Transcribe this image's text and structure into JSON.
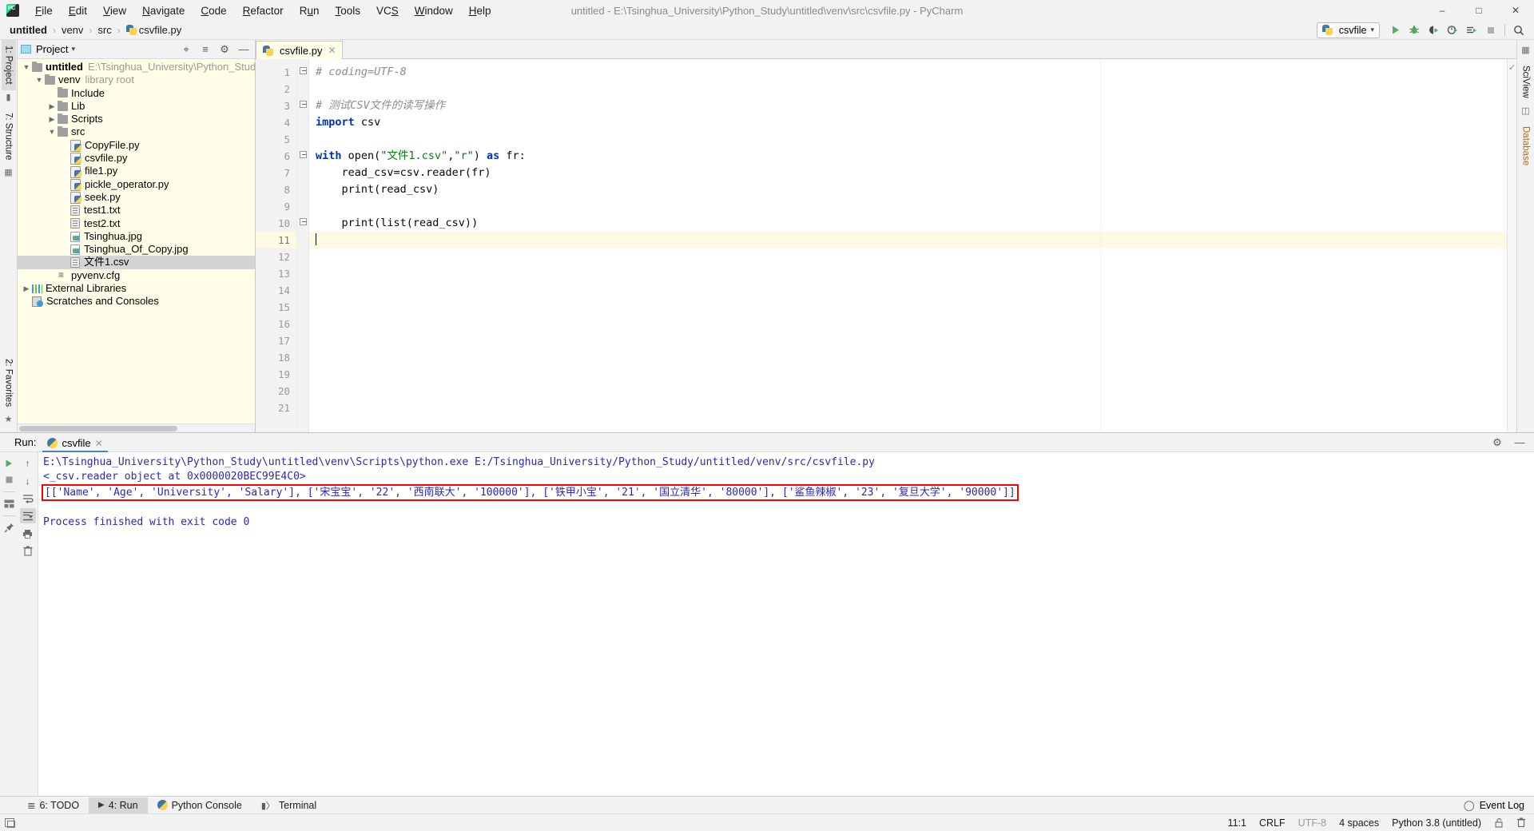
{
  "window": {
    "title": "untitled - E:\\Tsinghua_University\\Python_Study\\untitled\\venv\\src\\csvfile.py - PyCharm",
    "minimize": "–",
    "maximize": "□",
    "close": "✕"
  },
  "menu": {
    "items": [
      {
        "label": "File"
      },
      {
        "label": "Edit"
      },
      {
        "label": "View"
      },
      {
        "label": "Navigate"
      },
      {
        "label": "Code"
      },
      {
        "label": "Refactor"
      },
      {
        "label": "Run"
      },
      {
        "label": "Tools"
      },
      {
        "label": "VCS"
      },
      {
        "label": "Window"
      },
      {
        "label": "Help"
      }
    ]
  },
  "breadcrumb": {
    "items": [
      "untitled",
      "venv",
      "src",
      "csvfile.py"
    ],
    "separator": "›"
  },
  "toolbar": {
    "run_config": "csvfile",
    "dropdown_caret": "▾",
    "buttons": [
      {
        "name": "run-button",
        "glyph": "▶"
      },
      {
        "name": "debug-button",
        "glyph": "⚙"
      },
      {
        "name": "run-with-coverage-button",
        "glyph": "◑"
      },
      {
        "name": "profile-button",
        "glyph": "◴"
      },
      {
        "name": "run-tests-button",
        "glyph": "☰"
      },
      {
        "name": "stop-button",
        "glyph": "■"
      },
      {
        "name": "search-everywhere-button",
        "glyph": "⌕"
      }
    ]
  },
  "left_strip": {
    "project_tab": "1: Project",
    "structure_tab": "7: Structure",
    "favorites_tab": "2: Favorites"
  },
  "right_strip": {
    "sciview_tab": "SciView",
    "database_tab": "Database"
  },
  "project_panel": {
    "title": "Project",
    "caret": "▾",
    "header_buttons": [
      {
        "name": "locate-file-button",
        "glyph": "⌖"
      },
      {
        "name": "collapse-all-button",
        "glyph": "≡"
      },
      {
        "name": "settings-gear-button",
        "glyph": "⚙"
      },
      {
        "name": "hide-panel-button",
        "glyph": "—"
      }
    ],
    "tree": [
      {
        "indent": 0,
        "arrow": "▼",
        "icon": "folder",
        "label": "untitled",
        "bold": true,
        "sub": "E:\\Tsinghua_University\\Python_Stud",
        "selected": false
      },
      {
        "indent": 1,
        "arrow": "▼",
        "icon": "folder",
        "label": "venv",
        "bold": false,
        "sub": "library root",
        "selected": false
      },
      {
        "indent": 2,
        "arrow": "",
        "icon": "folder",
        "label": "Include",
        "bold": false,
        "sub": "",
        "selected": false
      },
      {
        "indent": 2,
        "arrow": "▶",
        "icon": "folder",
        "label": "Lib",
        "bold": false,
        "sub": "",
        "selected": false
      },
      {
        "indent": 2,
        "arrow": "▶",
        "icon": "folder",
        "label": "Scripts",
        "bold": false,
        "sub": "",
        "selected": false
      },
      {
        "indent": 2,
        "arrow": "▼",
        "icon": "folder",
        "label": "src",
        "bold": false,
        "sub": "",
        "selected": false
      },
      {
        "indent": 3,
        "arrow": "",
        "icon": "python",
        "label": "CopyFile.py",
        "bold": false,
        "sub": "",
        "selected": false
      },
      {
        "indent": 3,
        "arrow": "",
        "icon": "python",
        "label": "csvfile.py",
        "bold": false,
        "sub": "",
        "selected": false
      },
      {
        "indent": 3,
        "arrow": "",
        "icon": "python",
        "label": "file1.py",
        "bold": false,
        "sub": "",
        "selected": false
      },
      {
        "indent": 3,
        "arrow": "",
        "icon": "python",
        "label": "pickle_operator.py",
        "bold": false,
        "sub": "",
        "selected": false
      },
      {
        "indent": 3,
        "arrow": "",
        "icon": "python",
        "label": "seek.py",
        "bold": false,
        "sub": "",
        "selected": false
      },
      {
        "indent": 3,
        "arrow": "",
        "icon": "text",
        "label": "test1.txt",
        "bold": false,
        "sub": "",
        "selected": false
      },
      {
        "indent": 3,
        "arrow": "",
        "icon": "text",
        "label": "test2.txt",
        "bold": false,
        "sub": "",
        "selected": false
      },
      {
        "indent": 3,
        "arrow": "",
        "icon": "image",
        "label": "Tsinghua.jpg",
        "bold": false,
        "sub": "",
        "selected": false
      },
      {
        "indent": 3,
        "arrow": "",
        "icon": "image",
        "label": "Tsinghua_Of_Copy.jpg",
        "bold": false,
        "sub": "",
        "selected": false
      },
      {
        "indent": 3,
        "arrow": "",
        "icon": "text",
        "label": "文件1.csv",
        "bold": false,
        "sub": "",
        "selected": true
      },
      {
        "indent": 2,
        "arrow": "",
        "icon": "config",
        "label": "pyvenv.cfg",
        "bold": false,
        "sub": "",
        "selected": false
      },
      {
        "indent": 0,
        "arrow": "▶",
        "icon": "library",
        "label": "External Libraries",
        "bold": false,
        "sub": "",
        "selected": false
      },
      {
        "indent": 0,
        "arrow": "",
        "icon": "scratch",
        "label": "Scratches and Consoles",
        "bold": false,
        "sub": "",
        "selected": false
      }
    ]
  },
  "editor": {
    "tab": {
      "label": "csvfile.py",
      "close_glyph": "✕"
    },
    "total_lines": 21,
    "current_line": 11,
    "lines": [
      {
        "n": 1,
        "fold": "open",
        "tokens": [
          {
            "t": "# coding=UTF-8",
            "c": "cmt"
          }
        ]
      },
      {
        "n": 2,
        "fold": "",
        "tokens": []
      },
      {
        "n": 3,
        "fold": "box",
        "tokens": [
          {
            "t": "# 测试CSV文件的读写操作",
            "c": "cmt"
          }
        ]
      },
      {
        "n": 4,
        "fold": "",
        "tokens": [
          {
            "t": "import",
            "c": "kw"
          },
          {
            "t": " csv",
            "c": "plain"
          }
        ]
      },
      {
        "n": 5,
        "fold": "",
        "tokens": []
      },
      {
        "n": 6,
        "fold": "open",
        "tokens": [
          {
            "t": "with",
            "c": "kw"
          },
          {
            "t": " open(",
            "c": "plain"
          },
          {
            "t": "\"文件1.csv\"",
            "c": "str"
          },
          {
            "t": ",",
            "c": "plain"
          },
          {
            "t": "\"r\"",
            "c": "str"
          },
          {
            "t": ") ",
            "c": "plain"
          },
          {
            "t": "as",
            "c": "kw"
          },
          {
            "t": " fr:",
            "c": "plain"
          }
        ]
      },
      {
        "n": 7,
        "fold": "",
        "tokens": [
          {
            "t": "    read_csv=csv.reader(fr)",
            "c": "plain"
          }
        ]
      },
      {
        "n": 8,
        "fold": "",
        "tokens": [
          {
            "t": "    print(read_csv)",
            "c": "plain"
          }
        ]
      },
      {
        "n": 9,
        "fold": "",
        "tokens": []
      },
      {
        "n": 10,
        "fold": "box",
        "tokens": [
          {
            "t": "    print(list(read_csv))",
            "c": "plain"
          }
        ]
      },
      {
        "n": 11,
        "fold": "",
        "tokens": []
      },
      {
        "n": 12,
        "fold": "",
        "tokens": []
      },
      {
        "n": 13,
        "fold": "",
        "tokens": []
      },
      {
        "n": 14,
        "fold": "",
        "tokens": []
      },
      {
        "n": 15,
        "fold": "",
        "tokens": []
      },
      {
        "n": 16,
        "fold": "",
        "tokens": []
      },
      {
        "n": 17,
        "fold": "",
        "tokens": []
      },
      {
        "n": 18,
        "fold": "",
        "tokens": []
      },
      {
        "n": 19,
        "fold": "",
        "tokens": []
      },
      {
        "n": 20,
        "fold": "",
        "tokens": []
      },
      {
        "n": 21,
        "fold": "",
        "tokens": []
      }
    ]
  },
  "run_panel": {
    "label": "Run:",
    "tab_title": "csvfile",
    "tab_close": "✕",
    "settings_glyph": "⚙",
    "hide_glyph": "—",
    "tools": [
      {
        "name": "rerun-button",
        "glyph": "▶"
      },
      {
        "name": "stop-button",
        "glyph": "■"
      },
      {
        "name": "restore-layout-button",
        "glyph": "▤"
      },
      {
        "name": "pin-tab-button",
        "glyph": "✐"
      }
    ],
    "tools2": [
      {
        "name": "up-arrow-button",
        "glyph": "↑"
      },
      {
        "name": "down-arrow-button",
        "glyph": "↓"
      },
      {
        "name": "soft-wrap-button",
        "glyph": "↩"
      },
      {
        "name": "scroll-to-end-button",
        "glyph": "↧"
      },
      {
        "name": "print-button",
        "glyph": "⎙"
      },
      {
        "name": "clear-all-button",
        "glyph": "Ὕ1"
      }
    ],
    "console": {
      "command_line": "E:\\Tsinghua_University\\Python_Study\\untitled\\venv\\Scripts\\python.exe E:/Tsinghua_University/Python_Study/untitled/venv/src/csvfile.py",
      "reader_repr": "<_csv.reader object at 0x0000020BEC99E4C0>",
      "highlighted_output": "[['Name', 'Age', 'University', 'Salary'], ['宋宝宝', '22', '西南联大', '100000'], ['铁甲小宝', '21', '国立清华', '80000'], ['鲨鱼辣椒', '23', '复旦大学', '90000']]",
      "exit_line": "Process finished with exit code 0",
      "highlight_color": "#ff0000",
      "text_color": "#2b29b4"
    }
  },
  "bottom_tabs": {
    "items": [
      {
        "name": "bottom-tab-todo",
        "glyph": "≣",
        "label": "6: TODO",
        "active": false
      },
      {
        "name": "bottom-tab-run",
        "glyph": "▶",
        "label": "4: Run",
        "active": true
      },
      {
        "name": "bottom-tab-python-console",
        "glyph": "ⓣ",
        "label": "Python Console",
        "active": false
      },
      {
        "name": "bottom-tab-terminal",
        "glyph": "⌨",
        "label": "Terminal",
        "active": false
      }
    ],
    "event_log": "Event Log"
  },
  "statusbar": {
    "caret_position": "11:1",
    "line_separator": "CRLF",
    "encoding": "UTF-8",
    "indent": "4 spaces",
    "interpreter": "Python 3.8 (untitled)",
    "lock_glyph": "🔓",
    "trash_glyph": "⚙"
  }
}
